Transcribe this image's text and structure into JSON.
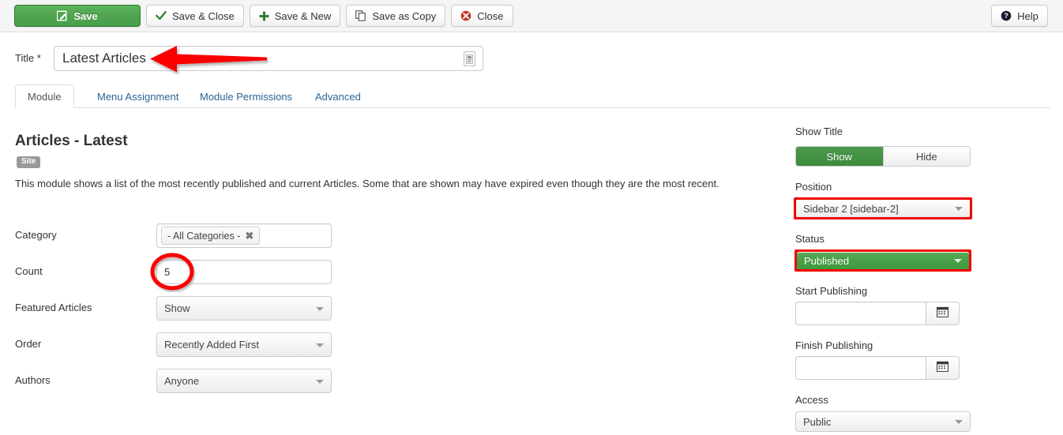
{
  "toolbar": {
    "buttons": [
      {
        "label": "Save",
        "icon": "save-pencil-icon",
        "style": "primary"
      },
      {
        "label": "Save & Close",
        "icon": "check-icon",
        "style": "default"
      },
      {
        "label": "Save & New",
        "icon": "plus-icon",
        "style": "default"
      },
      {
        "label": "Save as Copy",
        "icon": "copy-icon",
        "style": "default"
      },
      {
        "label": "Close",
        "icon": "cancel-circle-icon",
        "style": "default"
      }
    ],
    "help": {
      "label": "Help",
      "icon": "help-circle-icon"
    }
  },
  "title_field": {
    "label": "Title *",
    "value": "Latest Articles",
    "placeholder": "",
    "addon_icon": "article-icon"
  },
  "tabs": [
    {
      "label": "Module",
      "active": true
    },
    {
      "label": "Menu Assignment",
      "active": false
    },
    {
      "label": "Module Permissions",
      "active": false
    },
    {
      "label": "Advanced",
      "active": false
    }
  ],
  "module": {
    "heading": "Articles - Latest",
    "badge": "Site",
    "description": "This module shows a list of the most recently published and current Articles. Some that are shown may have expired even though they are the most recent."
  },
  "left_fields": [
    {
      "label": "Category",
      "type": "chips",
      "chip": "- All Categories -",
      "chip_remove": "✖"
    },
    {
      "label": "Count",
      "type": "text",
      "value": "5"
    },
    {
      "label": "Featured Articles",
      "type": "select",
      "value": "Show"
    },
    {
      "label": "Order",
      "type": "select",
      "value": "Recently Added First"
    },
    {
      "label": "Authors",
      "type": "select",
      "value": "Anyone"
    }
  ],
  "right_panel": {
    "show_title": {
      "label": "Show Title",
      "options": [
        "Show",
        "Hide"
      ],
      "selected": "Show"
    },
    "position": {
      "label": "Position",
      "value": "Sidebar 2 [sidebar-2]",
      "highlighted": true
    },
    "status": {
      "label": "Status",
      "value": "Published",
      "highlighted": true
    },
    "start_publishing": {
      "label": "Start Publishing",
      "value": "",
      "placeholder": "",
      "button_icon": "calendar-icon"
    },
    "finish_publishing": {
      "label": "Finish Publishing",
      "value": "",
      "placeholder": "",
      "button_icon": "calendar-icon"
    },
    "access": {
      "label": "Access",
      "value": "Public"
    }
  },
  "annotations": {
    "arrow": {
      "name": "red-arrow-annotation",
      "points_to": "Title input",
      "color": "#f20000"
    },
    "circle": {
      "name": "red-circle-annotation",
      "points_to": "Count value",
      "color": "#f20000"
    },
    "box_position": {
      "name": "red-box-annotation-position",
      "color": "#f20000"
    },
    "box_status": {
      "name": "red-box-annotation-status",
      "color": "#f20000"
    }
  },
  "colors": {
    "primary_green": "#3d8b3d",
    "annotation_red": "#f20000",
    "link_blue": "#2a6496",
    "toolbar_bg": "#f5f5f5",
    "badge_gray": "#999999"
  }
}
